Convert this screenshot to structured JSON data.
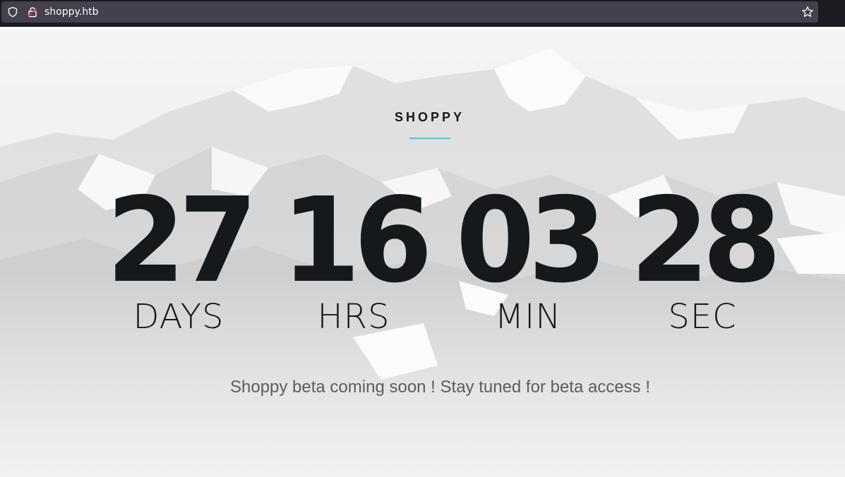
{
  "browser": {
    "url": "shoppy.htb",
    "icons": [
      "shield-icon",
      "lock-icon",
      "star-icon"
    ]
  },
  "brand": {
    "name": "SHOPPY",
    "accent_color": "#38c1d0"
  },
  "countdown": {
    "days": {
      "value": "27",
      "label": "DAYS"
    },
    "hours": {
      "value": "16",
      "label": "HRS"
    },
    "minutes": {
      "value": "03",
      "label": "MIN"
    },
    "seconds": {
      "value": "28",
      "label": "SEC"
    }
  },
  "tagline": "Shoppy beta coming soon ! Stay tuned for beta access !",
  "colors": {
    "text_dark": "#16191b",
    "tagline": "#5b5d5f",
    "chrome_bg": "#1c1b22",
    "urlbar_bg": "#42414d"
  }
}
